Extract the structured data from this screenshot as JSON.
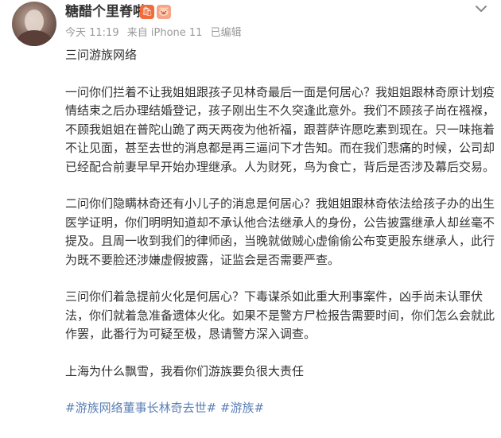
{
  "author": {
    "username": "糖醋个里脊啦",
    "badge_1": "🛍",
    "badge_2": "🐷"
  },
  "meta": {
    "time": "今天 11:19",
    "source": "来自 iPhone 11",
    "edited": "已编辑"
  },
  "post": {
    "title": "三问游族网络",
    "paragraph_1": "一问你们拦着不让我姐姐跟孩子见林奇最后一面是何居心？我姐姐跟林奇原计划疫情结束之后办理结婚登记，孩子刚出生不久突逢此意外。我们不顾孩子尚在襁褓，不顾我姐姐在普陀山跪了两天两夜为他祈福，跟菩萨许愿吃素到现在。只一味拖着不让见面，甚至去世的消息都是再三逼问下才告知。而在我们悲痛的时候，公司却已经配合前妻早早开始办理继承。人为财死，鸟为食亡，背后是否涉及幕后交易。",
    "paragraph_2": "二问你们隐瞒林奇还有小儿子的消息是何居心？我姐姐跟林奇依法给孩子办的出生医学证明，你们明明知道却不承认他合法继承人的身份，公告披露继承人却丝毫不提及。且周一收到我们的律师函，当晚就做贼心虚偷偷公布变更股东继承人，此行为既不要脸还涉嫌虚假披露，证监会是否需要严查。",
    "paragraph_3": "三问你们着急提前火化是何居心？下毒谋杀如此重大刑事案件，凶手尚未认罪伏法，你们就着急准备遗体火化。如果不是警方尸检报告需要时间，你们怎么会就此作罢，此番行为可疑至极，恳请警方深入调查。",
    "paragraph_4": "上海为什么飘雪，我看你们游族要负很大责任",
    "hashtag_1": "#游族网络董事长林奇去世#",
    "hashtag_2": "#游族#"
  },
  "colors": {
    "text": "#333333",
    "meta": "#999999",
    "link": "#5b7fb5"
  },
  "icons": {
    "more": "chevron-down-icon"
  }
}
